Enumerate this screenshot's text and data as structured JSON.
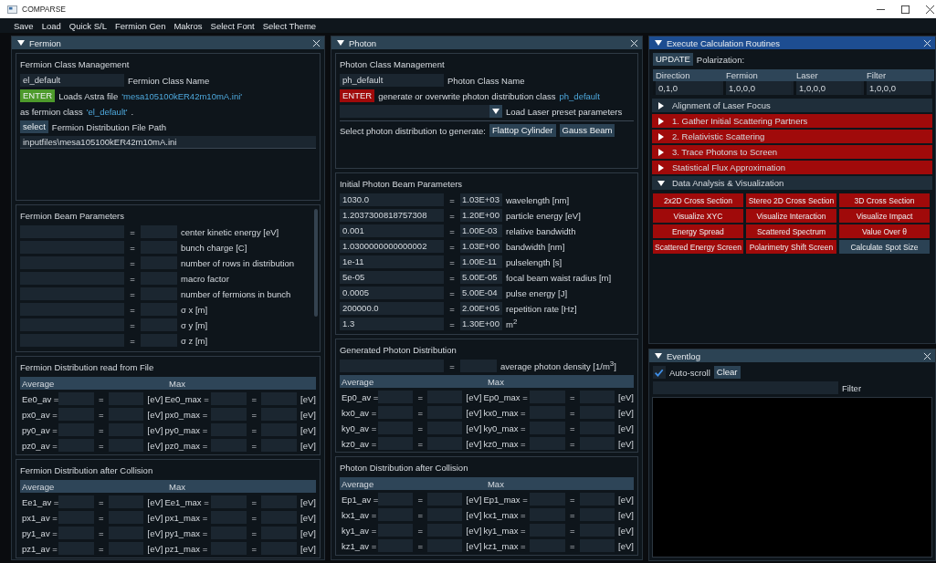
{
  "window": {
    "title": "COMPARSE"
  },
  "menu": [
    "Save",
    "Load",
    "Quick S/L",
    "Fermion Gen",
    "Makros",
    "Select Font",
    "Select Theme"
  ],
  "fermion": {
    "title": "Fermion",
    "focused": false,
    "class_management": {
      "heading": "Fermion Class Management",
      "name_value": "el_default",
      "name_label": "Fermion Class Name",
      "enter_button": {
        "label": "ENTER",
        "kind": "ready"
      },
      "load_text": "Loads Astra file",
      "file_name": "'mesa105100kER42m10mA.ini'",
      "as_text": "as fermion class",
      "class_name": "'el_default'",
      "period": ".",
      "select_button": "select",
      "path_label": "Fermion Distribution File Path",
      "path_value": "inputfiles\\mesa105100kER42m10mA.ini"
    },
    "beam_parameters": {
      "heading": "Fermion Beam Parameters",
      "rows": [
        {
          "eq": "=",
          "label": "center kinetic energy [eV]"
        },
        {
          "eq": "=",
          "label": "bunch charge [C]"
        },
        {
          "eq": "=",
          "label": "number of rows in distribution"
        },
        {
          "eq": "=",
          "label": "macro factor"
        },
        {
          "eq": "=",
          "label": "number of fermions in bunch"
        },
        {
          "eq": "=",
          "label": "σ x [m]"
        },
        {
          "eq": "=",
          "label": "σ y [m]"
        },
        {
          "eq": "=",
          "label": "σ z [m]"
        }
      ]
    },
    "distribution_read": {
      "heading": "Fermion Distribution read from File",
      "columns": [
        "Average",
        "Max"
      ],
      "rows": [
        {
          "av_label": "Ee0_av =",
          "av_eq": "=",
          "av_unit": "[eV]",
          "max_label": "Ee0_max =",
          "max_eq": "=",
          "max_unit": "[eV]"
        },
        {
          "av_label": "px0_av =",
          "av_eq": "=",
          "av_unit": "[eV]",
          "max_label": "px0_max =",
          "max_eq": "=",
          "max_unit": "[eV]"
        },
        {
          "av_label": "py0_av =",
          "av_eq": "=",
          "av_unit": "[eV]",
          "max_label": "py0_max =",
          "max_eq": "=",
          "max_unit": "[eV]"
        },
        {
          "av_label": "pz0_av =",
          "av_eq": "=",
          "av_unit": "[eV]",
          "max_label": "pz0_max =",
          "max_eq": "=",
          "max_unit": "[eV]"
        }
      ]
    },
    "distribution_after": {
      "heading": "Fermion Distribution after Collision",
      "columns": [
        "Average",
        "Max"
      ],
      "rows": [
        {
          "av_label": "Ee1_av =",
          "av_eq": "=",
          "av_unit": "[eV]",
          "max_label": "Ee1_max =",
          "max_eq": "=",
          "max_unit": "[eV]"
        },
        {
          "av_label": "px1_av =",
          "av_eq": "=",
          "av_unit": "[eV]",
          "max_label": "px1_max =",
          "max_eq": "=",
          "max_unit": "[eV]"
        },
        {
          "av_label": "py1_av =",
          "av_eq": "=",
          "av_unit": "[eV]",
          "max_label": "py1_max =",
          "max_eq": "=",
          "max_unit": "[eV]"
        },
        {
          "av_label": "pz1_av =",
          "av_eq": "=",
          "av_unit": "[eV]",
          "max_label": "pz1_max =",
          "max_eq": "=",
          "max_unit": "[eV]"
        }
      ]
    }
  },
  "photon": {
    "title": "Photon",
    "focused": false,
    "class_management": {
      "heading": "Photon Class Management",
      "name_value": "ph_default",
      "name_label": "Photon Class Name",
      "enter_button": {
        "label": "ENTER",
        "kind": "pending"
      },
      "generate_text": "generate or overwrite photon distribution class",
      "class_name": "ph_default",
      "preset_label": "Load Laser preset parameters",
      "select_text": "Select photon distribution to generate:",
      "distribution_buttons": [
        "Flattop Cylinder",
        "Gauss Beam"
      ]
    },
    "initial_parameters": {
      "heading": "Initial Photon Beam Parameters",
      "rows": [
        {
          "value": "1030.0",
          "eq": "=",
          "result": "1.03E+03",
          "label": "wavelength [nm]"
        },
        {
          "value": "1.2037300818757308",
          "eq": "=",
          "result": "1.20E+00",
          "label": "particle energy [eV]"
        },
        {
          "value": "0.001",
          "eq": "=",
          "result": "1.00E-03",
          "label": "relative bandwidth"
        },
        {
          "value": "1.0300000000000002",
          "eq": "=",
          "result": "1.03E+00",
          "label": "bandwidth [nm]"
        },
        {
          "value": "1e-11",
          "eq": "=",
          "result": "1.00E-11",
          "label": "pulselength [s]"
        },
        {
          "value": "5e-05",
          "eq": "=",
          "result": "5.00E-05",
          "label": "focal beam waist radius [m]"
        },
        {
          "value": "0.0005",
          "eq": "=",
          "result": "5.00E-04",
          "label": "pulse energy [J]"
        },
        {
          "value": "200000.0",
          "eq": "=",
          "result": "2.00E+05",
          "label": "repetition rate [Hz]"
        },
        {
          "value": "1.3",
          "eq": "=",
          "result": "1.30E+00",
          "label": "m$^{2}$"
        }
      ]
    },
    "generated": {
      "heading": "Generated Photon Distribution",
      "density_eq": "=",
      "density_label": "average photon density [1/m$^{3}$]",
      "columns": [
        "Average",
        "Max"
      ],
      "rows": [
        {
          "av_label": "Ep0_av =",
          "av_eq": "=",
          "av_unit": "[eV]",
          "max_label": "Ep0_max =",
          "max_eq": "=",
          "max_unit": "[eV]"
        },
        {
          "av_label": "kx0_av =",
          "av_eq": "=",
          "av_unit": "[eV]",
          "max_label": "kx0_max =",
          "max_eq": "=",
          "max_unit": "[eV]"
        },
        {
          "av_label": "ky0_av =",
          "av_eq": "=",
          "av_unit": "[eV]",
          "max_label": "ky0_max =",
          "max_eq": "=",
          "max_unit": "[eV]"
        },
        {
          "av_label": "kz0_av =",
          "av_eq": "=",
          "av_unit": "[eV]",
          "max_label": "kz0_max =",
          "max_eq": "=",
          "max_unit": "[eV]"
        }
      ]
    },
    "distribution_after": {
      "heading": "Photon Distribution after Collision",
      "columns": [
        "Average",
        "Max"
      ],
      "rows": [
        {
          "av_label": "Ep1_av =",
          "av_eq": "=",
          "av_unit": "[eV]",
          "max_label": "Ep1_max =",
          "max_eq": "=",
          "max_unit": "[eV]"
        },
        {
          "av_label": "kx1_av =",
          "av_eq": "=",
          "av_unit": "[eV]",
          "max_label": "kx1_max =",
          "max_eq": "=",
          "max_unit": "[eV]"
        },
        {
          "av_label": "ky1_av =",
          "av_eq": "=",
          "av_unit": "[eV]",
          "max_label": "ky1_max =",
          "max_eq": "=",
          "max_unit": "[eV]"
        },
        {
          "av_label": "kz1_av =",
          "av_eq": "=",
          "av_unit": "[eV]",
          "max_label": "kz1_max =",
          "max_eq": "=",
          "max_unit": "[eV]"
        }
      ]
    }
  },
  "execute": {
    "title": "Execute Calculation Routines",
    "focused": true,
    "update_button": "UPDATE",
    "polarization_label": "Polarization:",
    "polarization": {
      "columns": [
        "Direction",
        "Fermion",
        "Laser",
        "Filter"
      ],
      "values": [
        "0,1,0",
        "1,0,0,0",
        "1,0,0,0",
        "1,0,0,0"
      ]
    },
    "sections": [
      {
        "label": "Alignment of Laser Focus",
        "expanded": false,
        "kind": "neutral"
      },
      {
        "label": "1. Gather Initial Scattering Partners",
        "expanded": false,
        "kind": "pending"
      },
      {
        "label": "2. Relativistic Scattering",
        "expanded": false,
        "kind": "pending"
      },
      {
        "label": "3. Trace Photons to Screen",
        "expanded": false,
        "kind": "pending"
      },
      {
        "label": "Statistical Flux Approximation",
        "expanded": false,
        "kind": "pending"
      },
      {
        "label": "Data Analysis & Visualization",
        "expanded": true,
        "kind": "neutral"
      }
    ],
    "analysis_buttons": [
      {
        "label": "2x2D Cross Section",
        "kind": "pending"
      },
      {
        "label": "Stereo 2D Cross Section",
        "kind": "pending"
      },
      {
        "label": "3D Cross Section",
        "kind": "pending"
      },
      {
        "label": "Visualize XYC",
        "kind": "pending"
      },
      {
        "label": "Visualize Interaction",
        "kind": "pending"
      },
      {
        "label": "Visualize Impact",
        "kind": "pending"
      },
      {
        "label": "Energy Spread",
        "kind": "pending"
      },
      {
        "label": "Scattered Spectrum",
        "kind": "pending"
      },
      {
        "label": "Value Over θ",
        "kind": "pending"
      },
      {
        "label": "Scattered Energy Screen",
        "kind": "pending"
      },
      {
        "label": "Polarimetry Shift Screen",
        "kind": "pending"
      },
      {
        "label": "Calculate Spot Size",
        "kind": "neutral"
      }
    ]
  },
  "eventlog": {
    "title": "Eventlog",
    "focused": false,
    "auto_scroll": {
      "label": "Auto-scroll",
      "checked": true
    },
    "clear_button": "Clear",
    "filter_label": "Filter"
  }
}
